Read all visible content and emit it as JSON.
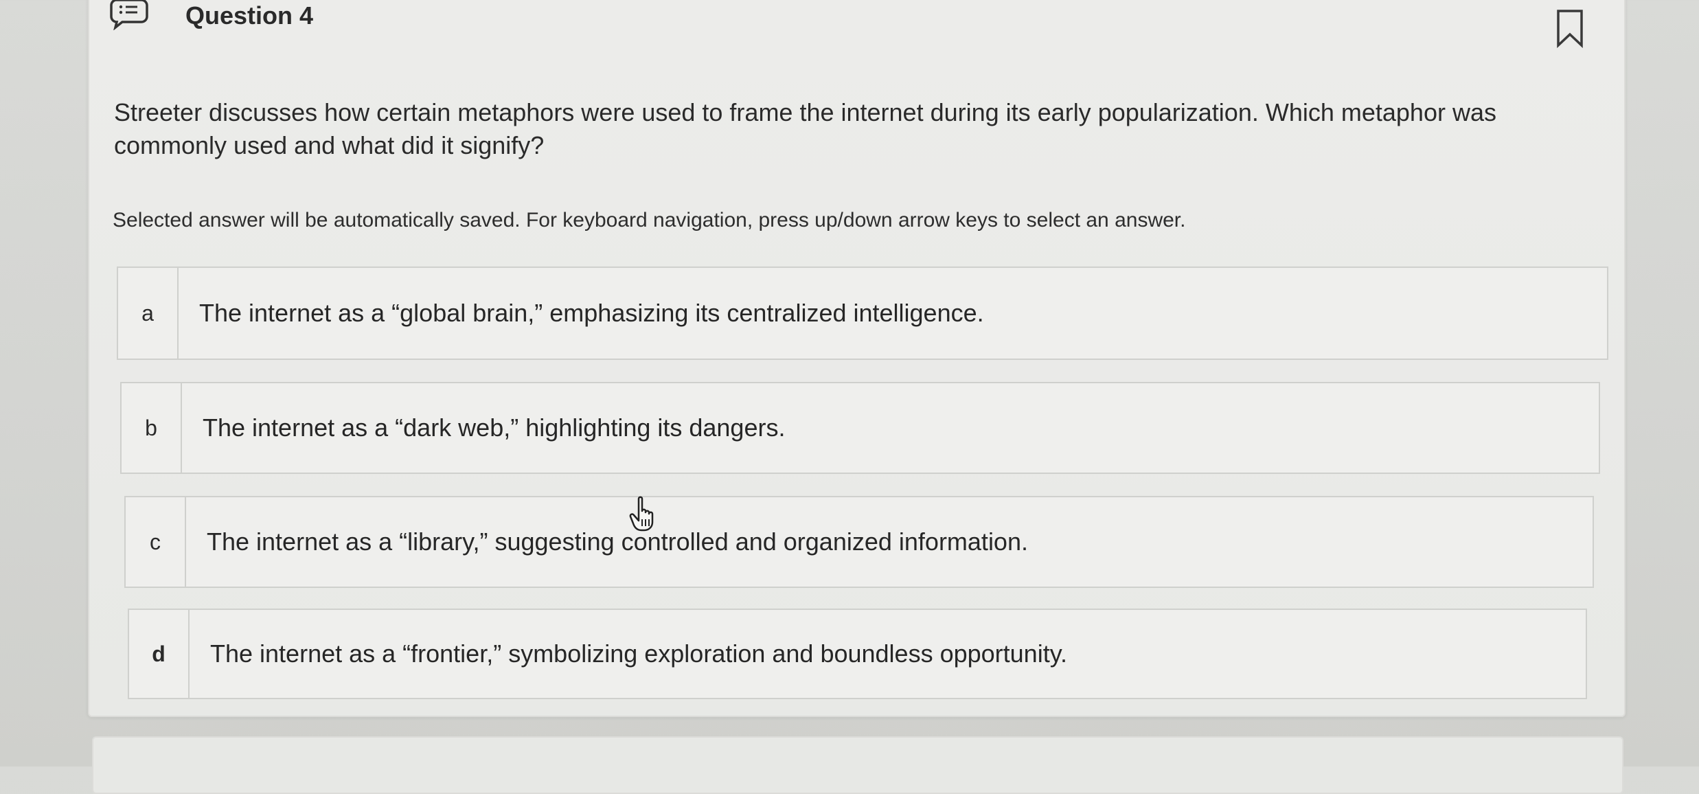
{
  "question": {
    "title": "Question 4",
    "text": "Streeter discusses how certain metaphors were used to frame the internet during its early popularization. Which metaphor was commonly used and what did it signify?",
    "instruction": "Selected answer will be automatically saved. For keyboard navigation, press up/down arrow keys to select an answer."
  },
  "options": [
    {
      "letter": "a",
      "text": "The internet as a “global brain,” emphasizing its centralized intelligence."
    },
    {
      "letter": "b",
      "text": "The internet as a “dark web,” highlighting its dangers."
    },
    {
      "letter": "c",
      "text": "The internet as a “library,” suggesting controlled and organized information."
    },
    {
      "letter": "d",
      "text": "The internet as a “frontier,” symbolizing exploration and boundless opportunity."
    }
  ],
  "icons": {
    "question_icon": "question-list-icon",
    "bookmark_icon": "bookmark-icon",
    "cursor_icon": "hand-pointer-icon"
  },
  "colors": {
    "background": "#d6d7d4",
    "card": "#ebebe9",
    "border": "#cfd0cd",
    "text": "#262626"
  }
}
